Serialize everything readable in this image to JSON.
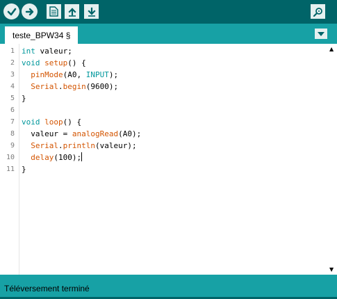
{
  "toolbar": {
    "buttons": [
      {
        "name": "verify",
        "icon": "checkmark-icon"
      },
      {
        "name": "upload",
        "icon": "right-arrow-icon"
      },
      {
        "name": "new",
        "icon": "new-file-icon"
      },
      {
        "name": "open",
        "icon": "open-up-arrow-icon"
      },
      {
        "name": "save",
        "icon": "save-down-arrow-icon"
      },
      {
        "name": "serial-monitor",
        "icon": "magnifier-icon"
      }
    ]
  },
  "tabs": {
    "active_label": "teste_BPW34 §",
    "menu_icon": "triangle-down-icon"
  },
  "editor": {
    "line_numbers": [
      "1",
      "2",
      "3",
      "4",
      "5",
      "6",
      "7",
      "8",
      "9",
      "10",
      "11"
    ],
    "lines": [
      [
        {
          "t": "int",
          "c": "type"
        },
        {
          "t": " valeur;",
          "c": ""
        }
      ],
      [
        {
          "t": "void",
          "c": "type"
        },
        {
          "t": " ",
          "c": ""
        },
        {
          "t": "setup",
          "c": "fn"
        },
        {
          "t": "() {",
          "c": ""
        }
      ],
      [
        {
          "t": "  ",
          "c": ""
        },
        {
          "t": "pinMode",
          "c": "fn"
        },
        {
          "t": "(A0, ",
          "c": ""
        },
        {
          "t": "INPUT",
          "c": "type"
        },
        {
          "t": ");",
          "c": ""
        }
      ],
      [
        {
          "t": "  ",
          "c": ""
        },
        {
          "t": "Serial",
          "c": "fn"
        },
        {
          "t": ".",
          "c": ""
        },
        {
          "t": "begin",
          "c": "fn"
        },
        {
          "t": "(9600);",
          "c": ""
        }
      ],
      [
        {
          "t": "}",
          "c": ""
        }
      ],
      [],
      [
        {
          "t": "void",
          "c": "type"
        },
        {
          "t": " ",
          "c": ""
        },
        {
          "t": "loop",
          "c": "fn"
        },
        {
          "t": "() {",
          "c": ""
        }
      ],
      [
        {
          "t": "  valeur = ",
          "c": ""
        },
        {
          "t": "analogRead",
          "c": "fn"
        },
        {
          "t": "(A0);",
          "c": ""
        }
      ],
      [
        {
          "t": "  ",
          "c": ""
        },
        {
          "t": "Serial",
          "c": "fn"
        },
        {
          "t": ".",
          "c": ""
        },
        {
          "t": "println",
          "c": "fn"
        },
        {
          "t": "(valeur);",
          "c": ""
        }
      ],
      [
        {
          "t": "  ",
          "c": ""
        },
        {
          "t": "delay",
          "c": "fn"
        },
        {
          "t": "(100);",
          "c": ""
        },
        {
          "t": "",
          "c": "caret"
        }
      ],
      [
        {
          "t": "}",
          "c": ""
        }
      ]
    ]
  },
  "status": {
    "message": "Téléversement terminé"
  },
  "colors": {
    "toolbar_bg": "#006468",
    "tabbar_bg": "#17a1a5",
    "keyword_type": "#00979c",
    "keyword_function": "#d35400"
  }
}
